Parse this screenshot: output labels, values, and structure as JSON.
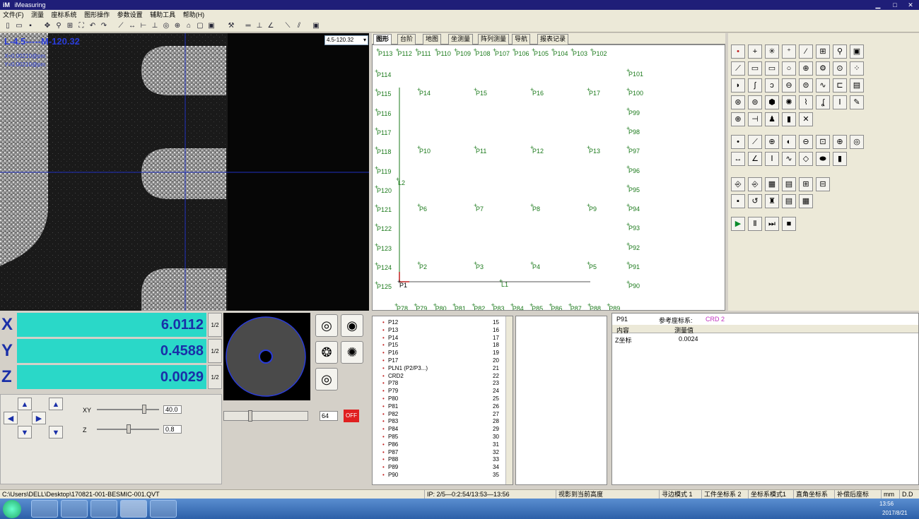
{
  "window": {
    "title": "iMeasuring",
    "logo": "iM",
    "min": "▁",
    "max": "□",
    "close": "✕"
  },
  "menu": [
    "文件(F)",
    "测量",
    "座标系统",
    "图形操作",
    "参数设置",
    "辅助工具",
    "帮助(H)"
  ],
  "camera": {
    "overlay_line1": "L-4.5-----M-120.32",
    "overlay_line2": "X=0.00210@pm",
    "overlay_line3": "Y=0.00210@pm",
    "zoom": "4.5-120.32",
    "zoom_arrow": "▾"
  },
  "tabs": [
    "图形",
    "台阶",
    "地图",
    "坐测量",
    "阵列测量",
    "导航",
    "报表记录"
  ],
  "graph": {
    "top_points": [
      "P113",
      "P112",
      "P111",
      "P110",
      "P109",
      "P108",
      "P107",
      "P106",
      "P105",
      "P104",
      "P103",
      "P102"
    ],
    "left_points": [
      "P114",
      "P115",
      "P116",
      "P117",
      "P118",
      "P119",
      "P120",
      "P121",
      "P122",
      "P123",
      "P124",
      "P125"
    ],
    "right_points": [
      "P101",
      "P100",
      "P99",
      "P98",
      "P97",
      "P96",
      "P95",
      "P94",
      "P93",
      "P92",
      "P91",
      "P90"
    ],
    "bottom_points": [
      "P78",
      "P79",
      "P80",
      "P81",
      "P82",
      "P83",
      "P84",
      "P85",
      "P86",
      "P87",
      "P88",
      "P89"
    ],
    "inner_row1": [
      "P14",
      "P15",
      "P16",
      "P17"
    ],
    "inner_row2": [
      "P10",
      "P11",
      "P12",
      "P13"
    ],
    "inner_row3": [
      "P6",
      "P7",
      "P8",
      "P9"
    ],
    "inner_row4": [
      "P2",
      "P3",
      "P4",
      "P5"
    ],
    "p1": "P1",
    "l1": "L1",
    "l2": "L2"
  },
  "dro": {
    "x_label": "X",
    "y_label": "Y",
    "z_label": "Z",
    "x": "6.0112",
    "y": "0.4588",
    "z": "0.0029",
    "half": "1/2"
  },
  "control": {
    "xy_label": "XY",
    "z_label": "Z",
    "xy_value": "40.0",
    "z_value": "0.8",
    "light_value": "64",
    "off_label": "OFF"
  },
  "objects": [
    {
      "name": "P12",
      "id": "15"
    },
    {
      "name": "P13",
      "id": "16"
    },
    {
      "name": "P14",
      "id": "17"
    },
    {
      "name": "P15",
      "id": "18"
    },
    {
      "name": "P16",
      "id": "19"
    },
    {
      "name": "P17",
      "id": "20"
    },
    {
      "name": "PLN1 (P2/P3...)",
      "id": "21"
    },
    {
      "name": "CRD2",
      "id": "22"
    },
    {
      "name": "P78",
      "id": "23"
    },
    {
      "name": "P79",
      "id": "24"
    },
    {
      "name": "P80",
      "id": "25"
    },
    {
      "name": "P81",
      "id": "26"
    },
    {
      "name": "P82",
      "id": "27"
    },
    {
      "name": "P83",
      "id": "28"
    },
    {
      "name": "P84",
      "id": "29"
    },
    {
      "name": "P85",
      "id": "30"
    },
    {
      "name": "P86",
      "id": "31"
    },
    {
      "name": "P87",
      "id": "32"
    },
    {
      "name": "P88",
      "id": "33"
    },
    {
      "name": "P89",
      "id": "34"
    },
    {
      "name": "P90",
      "id": "35"
    }
  ],
  "result": {
    "name": "P91",
    "ref_label": "参考座标系:",
    "ref_value": "CRD 2",
    "col1": "内容",
    "col2": "测量值",
    "row_label": "Z坐标",
    "row_value": "0.0024"
  },
  "status": {
    "path": "C:\\Users\\DELL\\Desktop\\170821-001-BESMIC-001.QVT",
    "ip": "IP: 2/5—0:2:54/13:53—13:56",
    "s1": "视影到当前高度",
    "s2": "寻边模式 1",
    "s3": "工件坐标系 2",
    "s4": "坐标系模式1",
    "s5": "直角坐标系",
    "s6": "补偿后座标",
    "s7": "mm",
    "s8": "D.D"
  },
  "taskbar": {
    "time": "13:56",
    "date": "2017/8/21"
  },
  "colors": {
    "accent": "#1f1e78",
    "dro_bg": "#2ad8c8",
    "point": "#1b7a1b"
  }
}
